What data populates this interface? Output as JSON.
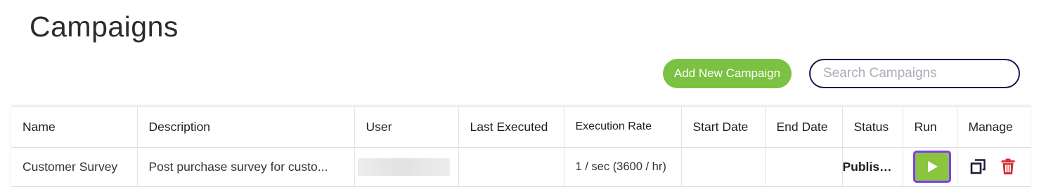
{
  "page": {
    "title": "Campaigns"
  },
  "toolbar": {
    "add_label": "Add New Campaign",
    "search_placeholder": "Search Campaigns",
    "search_value": ""
  },
  "table": {
    "columns": [
      "Name",
      "Description",
      "User",
      "Last Executed",
      "Execution Rate",
      "Start Date",
      "End Date",
      "Status",
      "Run",
      "Manage"
    ],
    "rows": [
      {
        "name": "Customer Survey",
        "description": "Post purchase survey for custo...",
        "user": "",
        "last_executed": "",
        "execution_rate": "1 / sec (3600 / hr)",
        "start_date": "",
        "end_date": "",
        "status": "Published"
      }
    ]
  },
  "icons": {
    "run": "play-icon",
    "copy": "copy-icon",
    "delete": "trash-icon"
  },
  "colors": {
    "add_button": "#7bc142",
    "search_border": "#1c1a4f",
    "run_button": "#8bc53f",
    "run_focus": "#7d3cf0",
    "copy_icon": "#1a1a3e",
    "delete_icon": "#d32f2f"
  }
}
